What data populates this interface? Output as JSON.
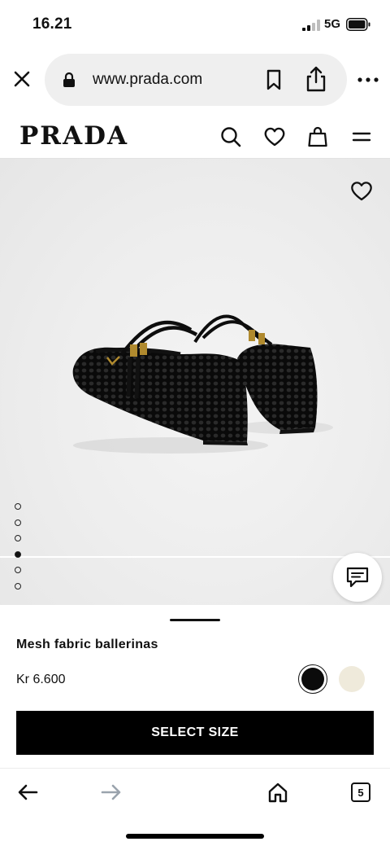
{
  "status_bar": {
    "time": "16.21",
    "network": "5G"
  },
  "browser": {
    "url": "www.prada.com",
    "open_tabs": "5"
  },
  "site": {
    "logo": "PRADA"
  },
  "gallery": {
    "image_count": 6,
    "active_index": 4
  },
  "product": {
    "name": "Mesh fabric ballerinas",
    "price": "Kr 6.600",
    "colors": [
      "#0b0b0b",
      "#efeadb"
    ],
    "selected_color_index": 0,
    "cta_label": "SELECT SIZE"
  },
  "icons": {
    "status": [
      "signal-icon",
      "battery-icon"
    ],
    "browser": [
      "close-icon",
      "lock-icon",
      "bookmark-icon",
      "share-icon",
      "more-icon"
    ],
    "header": [
      "search-icon",
      "heart-icon",
      "bag-icon",
      "menu-icon"
    ],
    "toolbar": [
      "back-arrow-icon",
      "forward-arrow-icon",
      "home-icon",
      "tabs-icon"
    ],
    "image": [
      "favorite-heart-icon",
      "chat-icon"
    ]
  }
}
